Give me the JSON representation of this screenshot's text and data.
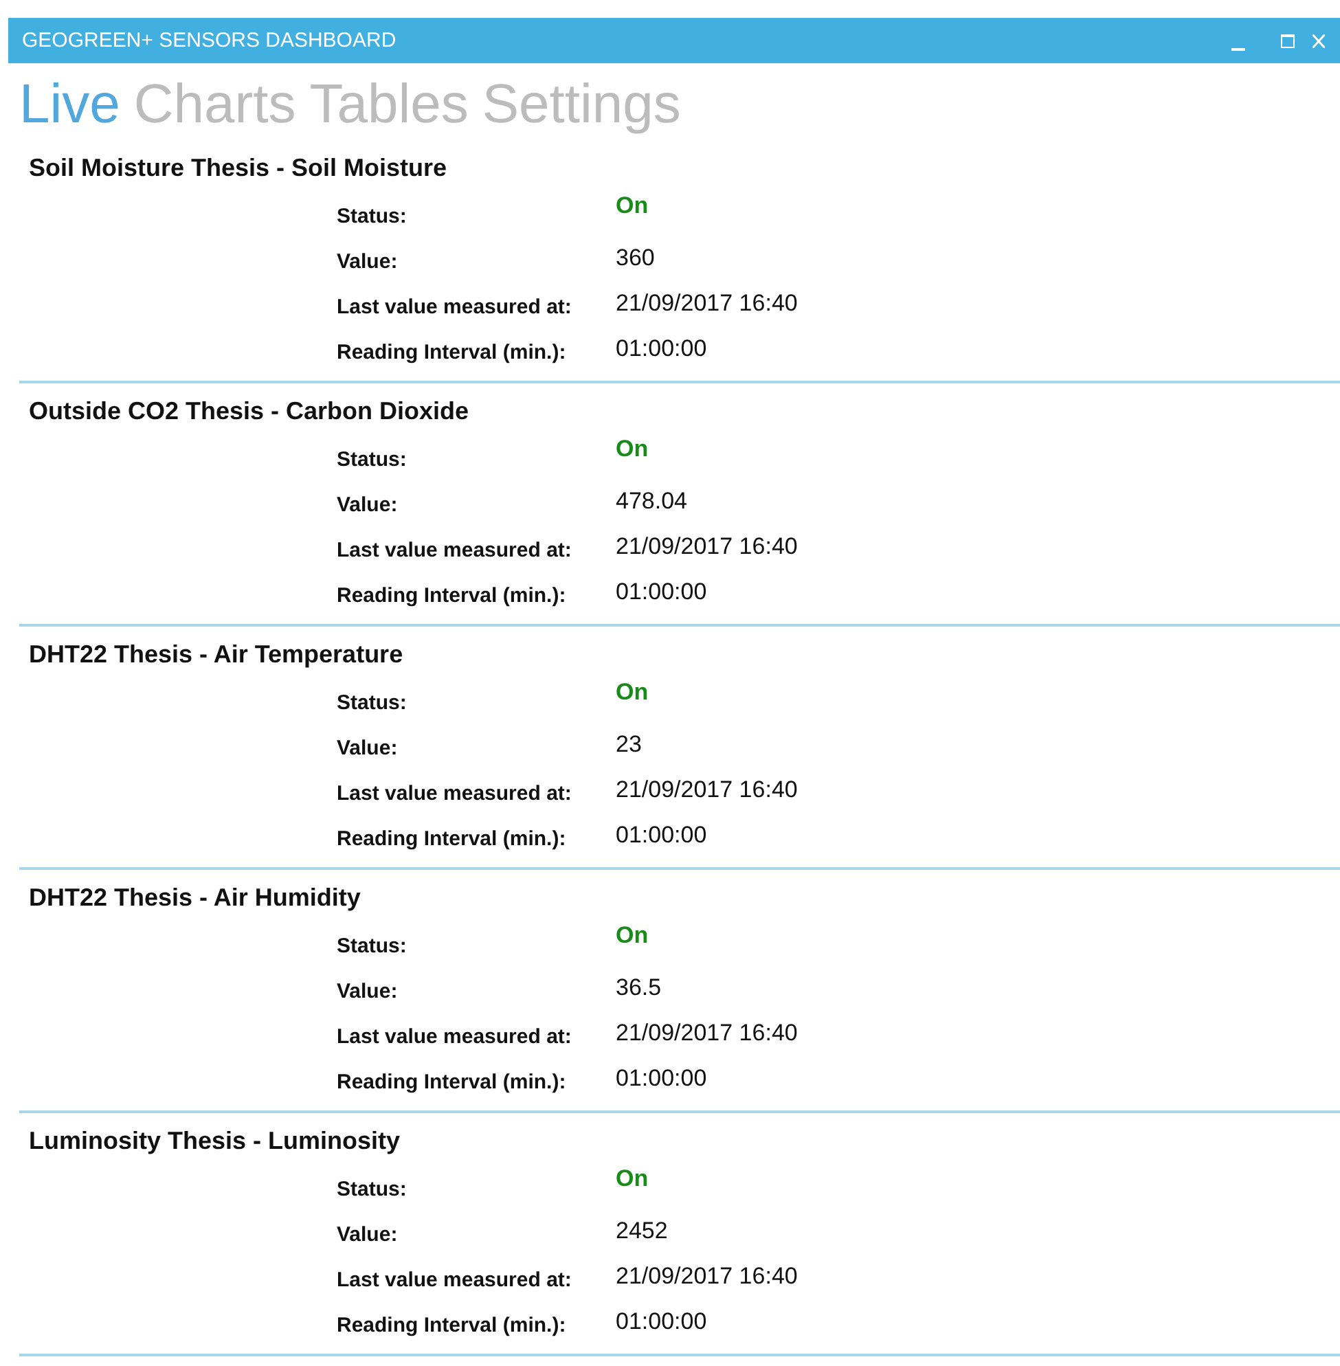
{
  "window": {
    "title": "GEOGREEN+ SENSORS DASHBOARD"
  },
  "tabs": [
    {
      "label": "Live",
      "selected": true
    },
    {
      "label": "Charts",
      "selected": false
    },
    {
      "label": "Tables",
      "selected": false
    },
    {
      "label": "Settings",
      "selected": false
    }
  ],
  "sensors": [
    {
      "title": "Soil Moisture Thesis - Soil Moisture",
      "fields": [
        {
          "kind": "status",
          "label": "Status:",
          "value": "On",
          "on": true
        },
        {
          "kind": "text",
          "label": "Value:",
          "value": "360"
        },
        {
          "kind": "text",
          "label": "Last value measured at:",
          "value": "21/09/2017 16:40"
        },
        {
          "kind": "text",
          "label": "Reading Interval (min.):",
          "value": "01:00:00"
        }
      ]
    },
    {
      "title": "Outside CO2 Thesis - Carbon Dioxide",
      "fields": [
        {
          "kind": "status",
          "label": "Status:",
          "value": "On",
          "on": true
        },
        {
          "kind": "text",
          "label": "Value:",
          "value": "478.04"
        },
        {
          "kind": "text",
          "label": "Last value measured at:",
          "value": "21/09/2017 16:40"
        },
        {
          "kind": "text",
          "label": "Reading Interval (min.):",
          "value": "01:00:00"
        }
      ]
    },
    {
      "title": "DHT22 Thesis - Air Temperature",
      "fields": [
        {
          "kind": "status",
          "label": "Status:",
          "value": "On",
          "on": true
        },
        {
          "kind": "text",
          "label": "Value:",
          "value": "23"
        },
        {
          "kind": "text",
          "label": "Last value measured at:",
          "value": "21/09/2017 16:40"
        },
        {
          "kind": "text",
          "label": "Reading Interval (min.):",
          "value": "01:00:00"
        }
      ]
    },
    {
      "title": "DHT22 Thesis - Air Humidity",
      "fields": [
        {
          "kind": "status",
          "label": "Status:",
          "value": "On",
          "on": true
        },
        {
          "kind": "text",
          "label": "Value:",
          "value": "36.5"
        },
        {
          "kind": "text",
          "label": "Last value measured at:",
          "value": "21/09/2017 16:40"
        },
        {
          "kind": "text",
          "label": "Reading Interval (min.):",
          "value": "01:00:00"
        }
      ]
    },
    {
      "title": "Luminosity Thesis - Luminosity",
      "fields": [
        {
          "kind": "status",
          "label": "Status:",
          "value": "On",
          "on": true
        },
        {
          "kind": "text",
          "label": "Value:",
          "value": "2452"
        },
        {
          "kind": "text",
          "label": "Last value measured at:",
          "value": "21/09/2017 16:40"
        },
        {
          "kind": "text",
          "label": "Reading Interval (min.):",
          "value": "01:00:00"
        }
      ]
    }
  ]
}
